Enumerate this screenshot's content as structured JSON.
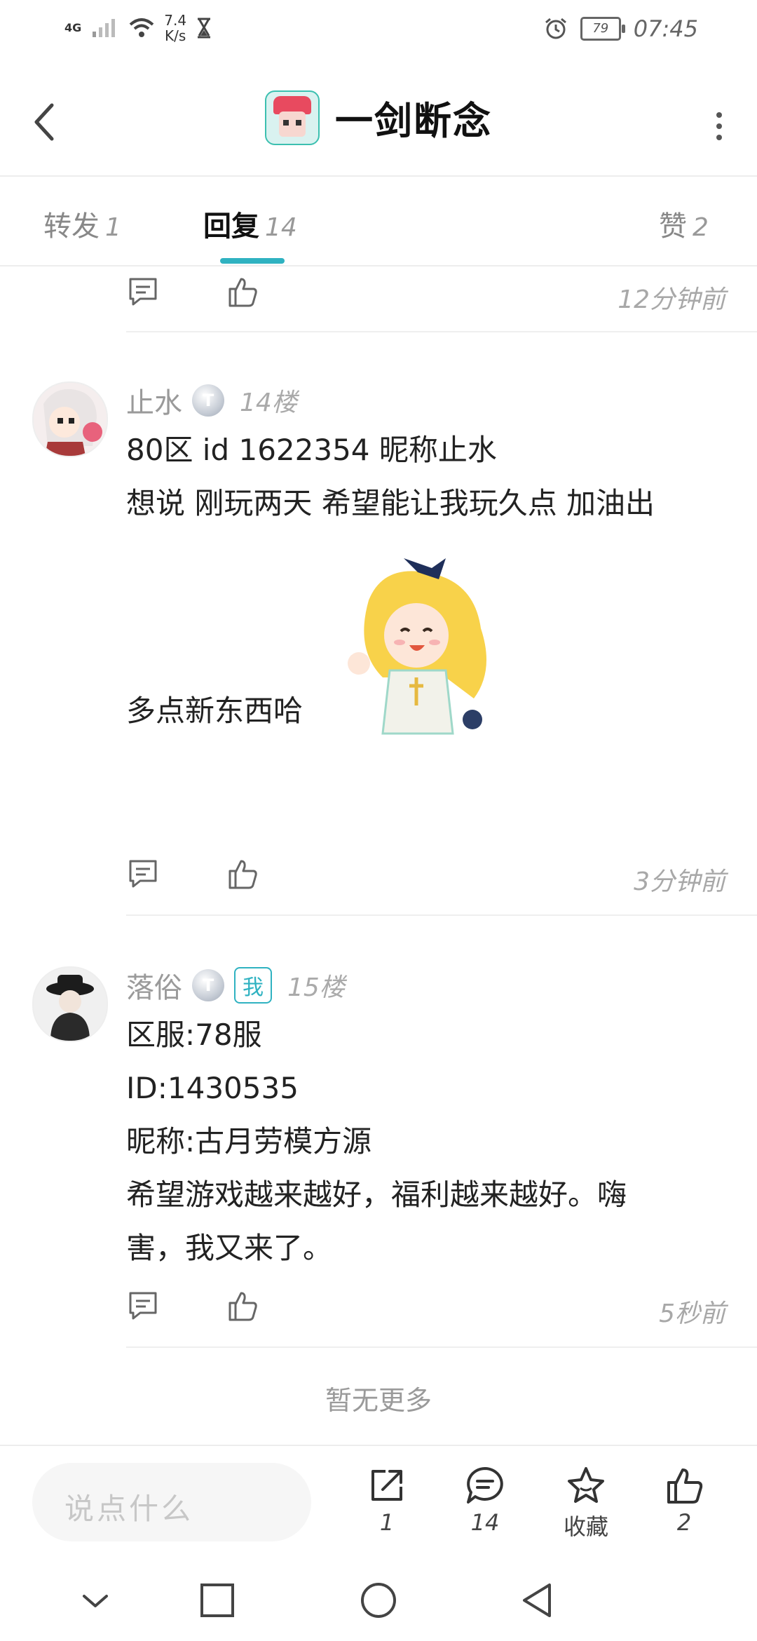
{
  "status_bar": {
    "network": "4G",
    "speed_value": "7.4",
    "speed_unit": "K/s",
    "battery": "79",
    "time": "07:45"
  },
  "header": {
    "title": "一剑断念"
  },
  "tabs": [
    {
      "label": "转发",
      "count": "1"
    },
    {
      "label": "回复",
      "count": "14"
    },
    {
      "label": "赞",
      "count": "2"
    }
  ],
  "partial_row": {
    "time": "12分钟前"
  },
  "replies": [
    {
      "username": "止水",
      "level": "T",
      "floor": "14楼",
      "lines": [
        "80区  id 1622354 昵称止水",
        "想说 刚玩两天 希望能让我玩久点 加油出",
        "多点新东西哈"
      ],
      "time": "3分钟前"
    },
    {
      "username": "落俗",
      "level": "T",
      "me_badge": "我",
      "floor": "15楼",
      "lines": [
        "区服:78服",
        "ID:1430535",
        "昵称:古月劳模方源",
        "希望游戏越来越好，福利越来越好。嗨",
        "害，我又来了。"
      ],
      "time": "5秒前"
    }
  ],
  "no_more": "暂无更多",
  "bottom_bar": {
    "input_placeholder": "说点什么",
    "share_count": "1",
    "comment_count": "14",
    "favorite_label": "收藏",
    "like_count": "2"
  },
  "icons": {
    "accent_color": "#2fb2c1"
  }
}
